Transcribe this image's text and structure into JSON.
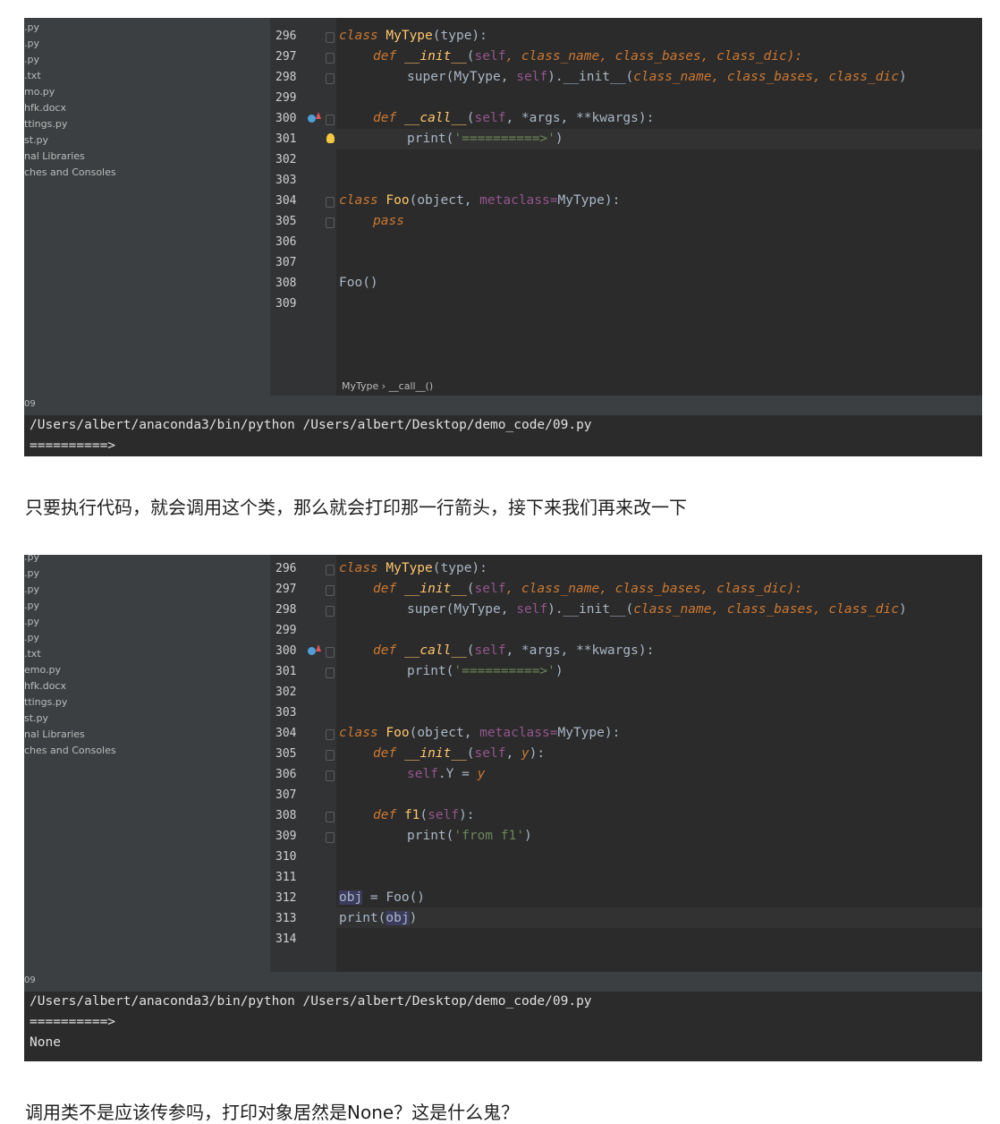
{
  "screenshot1": {
    "file_tree": [
      ".py",
      ".py",
      ".py",
      ".txt",
      "mo.py",
      "hfk.docx",
      "ttings.py",
      "st.py",
      "nal Libraries",
      "ches and Consoles"
    ],
    "line_numbers": [
      "296",
      "297",
      "298",
      "299",
      "300",
      "301",
      "302",
      "303",
      "304",
      "305",
      "306",
      "307",
      "308",
      "309"
    ],
    "code": {
      "l296_kw": "class",
      "l296_name": "MyType",
      "l296_rest": "(type):",
      "l297_def": "def",
      "l297_fn": "__init__",
      "l297_open": "(",
      "l297_self": "self",
      "l297_params": ", class_name, class_bases, class_dic):",
      "l298_super": "super(MyType, ",
      "l298_self": "self",
      "l298_init": ").__init__(",
      "l298_params": "class_name, class_bases, class_dic",
      "l298_close": ")",
      "l300_def": "def",
      "l300_fn": "__call__",
      "l300_open": "(",
      "l300_self": "self",
      "l300_rest": ", *args, **kwargs):",
      "l301_print": "print(",
      "l301_str": "'==========>'",
      "l301_close": ")",
      "l304_kw": "class",
      "l304_name": "Foo",
      "l304_obj": "(object, ",
      "l304_meta": "metaclass=",
      "l304_rest": "MyType):",
      "l305_pass": "pass",
      "l308_call": "Foo()"
    },
    "breadcrumb": "MyType  ›  __call__()",
    "run_tab": "09",
    "console": [
      "/Users/albert/anaconda3/bin/python /Users/albert/Desktop/demo_code/09.py",
      "==========>"
    ]
  },
  "paragraph1": "只要执行代码，就会调用这个类，那么就会打印那一行箭头，接下来我们再来改一下",
  "screenshot2": {
    "file_tree": [
      ".py",
      ".py",
      ".py",
      ".py",
      ".py",
      ".py",
      ".txt",
      "emo.py",
      "hfk.docx",
      "ttings.py",
      "st.py",
      "nal Libraries",
      "ches and Consoles"
    ],
    "line_numbers": [
      "296",
      "297",
      "298",
      "299",
      "300",
      "301",
      "302",
      "303",
      "304",
      "305",
      "306",
      "307",
      "308",
      "309",
      "310",
      "311",
      "312",
      "313",
      "314"
    ],
    "code": {
      "l296_kw": "class",
      "l296_name": "MyType",
      "l296_rest": "(type):",
      "l297_def": "def",
      "l297_fn": "__init__",
      "l297_open": "(",
      "l297_self": "self",
      "l297_params": ", class_name, class_bases, class_dic):",
      "l298_super": "super(MyType, ",
      "l298_self": "self",
      "l298_init": ").__init__(",
      "l298_params": "class_name, class_bases, class_dic",
      "l298_close": ")",
      "l300_def": "def",
      "l300_fn": "__call__",
      "l300_open": "(",
      "l300_self": "self",
      "l300_rest": ", *args, **kwargs):",
      "l301_print": "print(",
      "l301_str": "'==========>'",
      "l301_close": ")",
      "l304_kw": "class",
      "l304_name": "Foo",
      "l304_obj": "(object, ",
      "l304_meta": "metaclass=",
      "l304_rest": "MyType):",
      "l305_def": "def",
      "l305_fn": "__init__",
      "l305_open": "(",
      "l305_self": "self",
      "l305_comma": ", ",
      "l305_y": "y",
      "l305_close": "):",
      "l306_self": "self",
      "l306_attr": ".Y = ",
      "l306_y": "y",
      "l308_def": "def",
      "l308_fn": "f1",
      "l308_open": "(",
      "l308_self": "self",
      "l308_close": "):",
      "l309_print": "print(",
      "l309_str": "'from f1'",
      "l309_close": ")",
      "l312_obj": "obj",
      "l312_rest": " = Foo()",
      "l313_print": "print(",
      "l313_obj": "obj",
      "l313_close": ")"
    },
    "run_tab": "09",
    "console": [
      "/Users/albert/anaconda3/bin/python /Users/albert/Desktop/demo_code/09.py",
      "==========>",
      "None"
    ]
  },
  "paragraph2": "调用类不是应该传参吗，打印对象居然是None？这是什么鬼？"
}
